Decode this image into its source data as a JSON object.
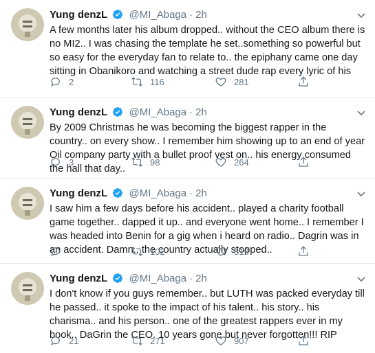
{
  "tweets": [
    {
      "name": "Yung denzL",
      "handle": "@MI_Abaga",
      "dot": "·",
      "time": "2h",
      "text": "A few months later his album dropped.. without the CEO album there is no MI2.. I was chasing the template he set..something so powerful but so easy for the everyday fan to relate to.. the epiphany came one day sitting in Obanikoro and watching a street dude rap every lyric of his",
      "replies": "2",
      "retweets": "116",
      "likes": "281"
    },
    {
      "name": "Yung denzL",
      "handle": "@MI_Abaga",
      "dot": "·",
      "time": "2h",
      "text": "By 2009 Christmas he was becoming the biggest rapper in the country.. on every show.. I remember him showing up to an end of year Oil company party with a bullet proof vest on.. his energy consumed the hall that day..",
      "replies": "3",
      "retweets": "98",
      "likes": "264"
    },
    {
      "name": "Yung denzL",
      "handle": "@MI_Abaga",
      "dot": "·",
      "time": "2h",
      "text": "I saw him a few days before his accident.. played a charity football game together.. dapped it up.. and everyone went home.. I remember I was headed into Benin for a gig when i heard on radio.. Dagrin was in an accident. Damn.. the country actually stopped..",
      "replies": "",
      "retweets": "102",
      "likes": "319"
    },
    {
      "name": "Yung denzL",
      "handle": "@MI_Abaga",
      "dot": "·",
      "time": "2h",
      "text": "I don't know if you guys remember.. but LUTH was packed everyday till he passed.. it spoke to the impact of his talent.. his story.. his charisma.. and his person.. one of the greatest rappers ever in my book.. DaGrin the CEO. 10 years gone but never forgotten!!! RIP",
      "replies": "21",
      "retweets": "271",
      "likes": "907"
    }
  ],
  "colors": {
    "text": "#14171a",
    "secondary": "#657786",
    "verified": "#1da1f2",
    "divider": "#e6ecf0"
  },
  "icons": [
    "avatar",
    "verified-badge-icon",
    "caret-down-icon",
    "reply-icon",
    "retweet-icon",
    "like-icon",
    "share-icon"
  ]
}
